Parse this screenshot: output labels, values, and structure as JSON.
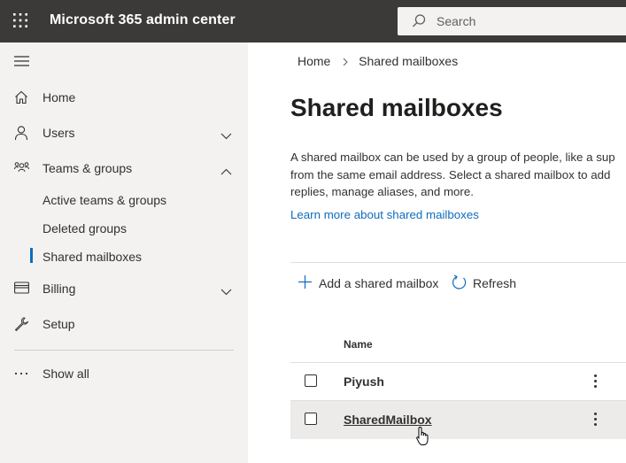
{
  "header": {
    "app_title": "Microsoft 365 admin center",
    "search_placeholder": "Search",
    "background": "#3b3a39"
  },
  "sidebar": {
    "items": [
      {
        "label": "Home",
        "icon": "home-icon",
        "expanded": null
      },
      {
        "label": "Users",
        "icon": "person-icon",
        "expanded": false
      },
      {
        "label": "Teams & groups",
        "icon": "people-icon",
        "expanded": true
      },
      {
        "label": "Billing",
        "icon": "credit-card-icon",
        "expanded": false
      },
      {
        "label": "Setup",
        "icon": "wrench-icon",
        "expanded": null
      }
    ],
    "subitems": [
      {
        "label": "Active teams & groups",
        "selected": false
      },
      {
        "label": "Deleted groups",
        "selected": false
      },
      {
        "label": "Shared mailboxes",
        "selected": true
      }
    ],
    "show_all": "Show all",
    "selected_accent": "#0f6cbd"
  },
  "main": {
    "breadcrumb": [
      "Home",
      "Shared mailboxes"
    ],
    "title": "Shared mailboxes",
    "description_lines": [
      "A shared mailbox can be used by a group of people, like a sup",
      "from the same email address. Select a shared mailbox to add",
      "replies, manage aliases, and more."
    ],
    "learn_more": "Learn more about shared mailboxes",
    "commands": {
      "add": "Add a shared mailbox",
      "refresh": "Refresh"
    },
    "table": {
      "columns": [
        "Name"
      ],
      "rows": [
        {
          "name": "Piyush",
          "checked": false
        },
        {
          "name": "SharedMailbox",
          "checked": false,
          "hovered": true
        }
      ]
    },
    "link_color": "#0f6cbd"
  }
}
